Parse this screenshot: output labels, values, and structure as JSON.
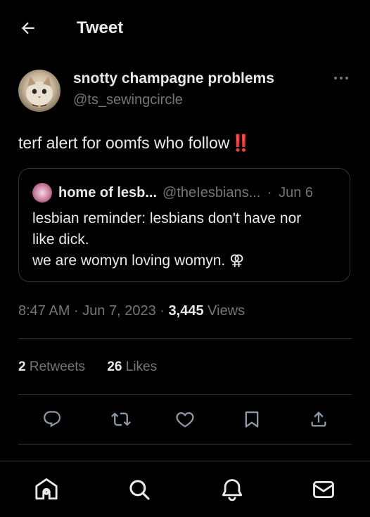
{
  "header": {
    "title": "Tweet"
  },
  "author": {
    "display_name": "snotty champagne problems",
    "handle": "@ts_sewingcircle"
  },
  "tweet": {
    "text": "terf alert for oomfs who follow",
    "emoji": "‼️"
  },
  "quote": {
    "name": "home of lesb...",
    "handle": "@theIesbians...",
    "separator": "·",
    "date": "Jun 6",
    "lines": [
      "lesbian reminder: lesbians don't have nor",
      "like dick.",
      "we are womyn loving womyn. ⚢"
    ]
  },
  "meta": {
    "time": "8:47 AM",
    "sep1": "·",
    "date": "Jun 7, 2023",
    "sep2": "·",
    "views_count": "3,445",
    "views_label": "Views"
  },
  "stats": {
    "retweets_count": "2",
    "retweets_label": "Retweets",
    "likes_count": "26",
    "likes_label": "Likes"
  },
  "icons": {
    "back": "arrow-left-icon",
    "more": "more-dots-icon",
    "reply": "reply-icon",
    "retweet": "retweet-icon",
    "like": "heart-icon",
    "bookmark": "bookmark-icon",
    "share": "share-icon",
    "home": "home-icon",
    "search": "search-icon",
    "notifications": "bell-icon",
    "messages": "mail-icon"
  },
  "colors": {
    "background": "#000000",
    "text": "#e7e9ea",
    "secondary": "#71767b",
    "border": "#2f3336",
    "emoji_red": "#e0242c"
  }
}
